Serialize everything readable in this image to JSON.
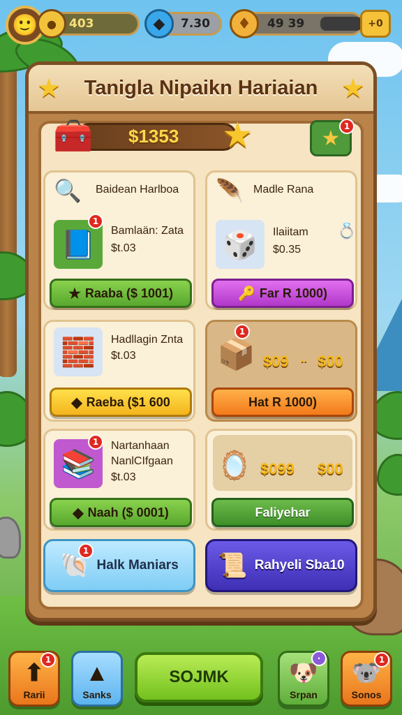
{
  "hud": {
    "coins": "403",
    "gems": "7.30",
    "energy": "49 39",
    "plus_label": "+0"
  },
  "panel": {
    "title": "Tanigla Nipaikn Hariaian",
    "balance": "$1353"
  },
  "cards": [
    {
      "header": "Baidean Harlboa",
      "item_name": "Bamlaän: Zata",
      "price": "$t.03",
      "button": "Raaba ($ 1001)",
      "badge": "1"
    },
    {
      "header": "Madle Rana",
      "item_name": "Ilaiitam",
      "price": "$0.35",
      "button": "Far R 1000)"
    },
    {
      "item_name": "Hadllagin Znta",
      "price": "$t.03",
      "button": "Raeba ($1 600"
    },
    {
      "price_a": "$09",
      "sep": "..",
      "price_b": "$00",
      "button": "Hat R 1000)",
      "badge": "1"
    },
    {
      "item_name_1": "Nartanhaan",
      "item_name_2": "NanlCIfgaan",
      "price": "$t.03",
      "button": "Naah ($ 0001)",
      "badge": "1"
    },
    {
      "price_a": "$099",
      "price_b": "$00",
      "button": "Faliyehar"
    }
  ],
  "wide_buttons": {
    "left": "Halk Maniars",
    "right": "Rahyeli Sba10",
    "left_badge": "1"
  },
  "nav": {
    "items": [
      {
        "label": "Rarii",
        "icon": "arrow-icon",
        "badge": "1"
      },
      {
        "label": "Sanks",
        "icon": "pyramid-icon"
      },
      {
        "label": "SOJMK",
        "icon": "play-button"
      },
      {
        "label": "Srpan",
        "icon": "pet-icon"
      },
      {
        "label": "Sonos",
        "icon": "koala-icon",
        "badge": "1"
      }
    ]
  },
  "colors": {
    "panel_wood": "#b9834a",
    "panel_cream": "#f6e4c2",
    "accent_gold": "#f4b81a",
    "button_green": "#58a72e",
    "button_purple": "#b138c9"
  }
}
